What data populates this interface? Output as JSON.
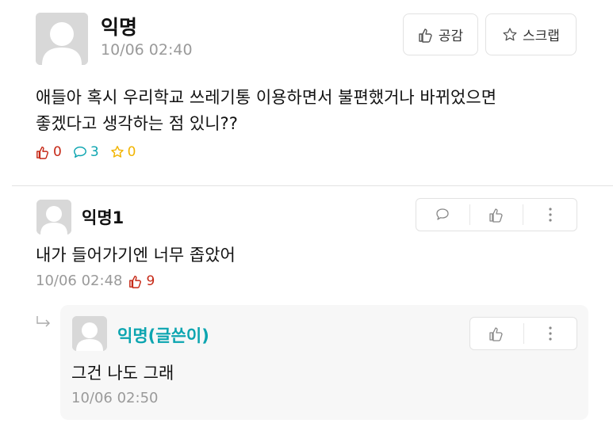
{
  "post": {
    "author": "익명",
    "time": "10/06 02:40",
    "body_line1": "애들아 혹시 우리학교 쓰레기통 이용하면서 불편했거나 바뀌었으면",
    "body_line2": "좋겠다고 생각하는 점 있니??",
    "like_label": "공감",
    "scrap_label": "스크랩",
    "likes": "0",
    "comments": "3",
    "scraps": "0"
  },
  "comment": {
    "author": "익명1",
    "body": "내가 들어가기엔 너무 좁았어",
    "time": "10/06 02:48",
    "likes": "9"
  },
  "reply": {
    "author": "익명(글쓴이)",
    "body": "그건 나도 그래",
    "time": "10/06 02:50"
  },
  "colors": {
    "like_red": "#c62917",
    "comment_cyan": "#0ca5b0",
    "scrap_yellow": "#f2b400",
    "author_teal": "#0ca5b0",
    "reply_bg": "#f7f7f7"
  }
}
